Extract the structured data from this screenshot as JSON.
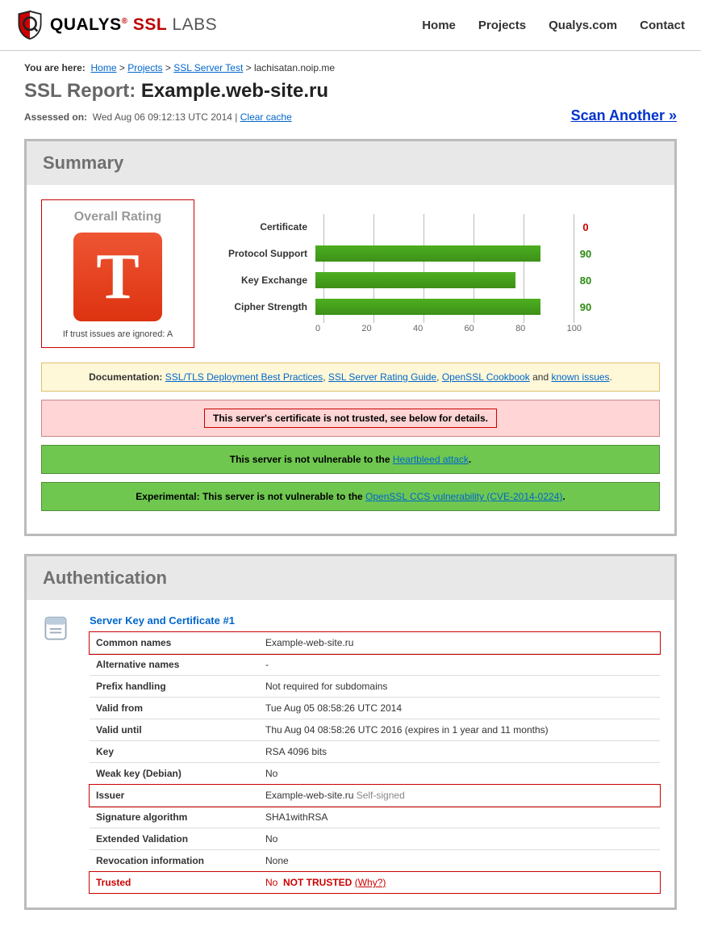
{
  "nav": {
    "home": "Home",
    "projects": "Projects",
    "qualys": "Qualys.com",
    "contact": "Contact"
  },
  "logo": {
    "brand": "QUALYS",
    "reg": "®",
    "ssl": "SSL",
    "labs": " LABS"
  },
  "breadcrumb": {
    "label": "You are here:",
    "home": "Home",
    "projects": "Projects",
    "ssltest": "SSL Server Test",
    "leaf": "lachisatan.noip.me"
  },
  "title": {
    "prefix": "SSL Report: ",
    "host": "Example.web-site.ru"
  },
  "assessed": {
    "label": "Assessed on:",
    "ts": "Wed Aug 06 09:12:13 UTC 2014",
    "clear": "Clear cache"
  },
  "scan_another": "Scan Another »",
  "summary": {
    "heading": "Summary",
    "rating_title": "Overall Rating",
    "grade": "T",
    "rating_note": "If trust issues are ignored: A",
    "axis": [
      "0",
      "20",
      "40",
      "60",
      "80",
      "100"
    ]
  },
  "chart_data": {
    "type": "bar",
    "categories": [
      "Certificate",
      "Protocol Support",
      "Key Exchange",
      "Cipher Strength"
    ],
    "values": [
      0,
      90,
      80,
      90
    ],
    "xlim": [
      0,
      100
    ]
  },
  "docs": {
    "prefix": "Documentation: ",
    "l1": "SSL/TLS Deployment Best Practices",
    "l2": "SSL Server Rating Guide",
    "l3": "OpenSSL Cookbook",
    "mid": " and ",
    "l4": "known issues"
  },
  "alerts": {
    "untrusted": "This server's certificate is not trusted, see below for details.",
    "hb_pre": "This server is not vulnerable to the ",
    "hb_link": "Heartbleed attack",
    "ccs_pre": "Experimental: This server is not vulnerable to the ",
    "ccs_link": "OpenSSL CCS vulnerability (CVE-2014-0224)"
  },
  "auth": {
    "heading": "Authentication",
    "section": "Server Key and Certificate #1",
    "rows": {
      "cn_k": "Common names",
      "cn_v": "Example-web-site.ru",
      "alt_k": "Alternative names",
      "alt_v": "-",
      "pfx_k": "Prefix handling",
      "pfx_v": "Not required for subdomains",
      "vf_k": "Valid from",
      "vf_v": "Tue Aug 05 08:58:26 UTC 2014",
      "vu_k": "Valid until",
      "vu_v": "Thu Aug 04 08:58:26 UTC 2016 (expires in 1 year and 11 months)",
      "key_k": "Key",
      "key_v": "RSA 4096 bits",
      "wk_k": "Weak key (Debian)",
      "wk_v": "No",
      "iss_k": "Issuer",
      "iss_v": "Example-web-site.ru",
      "iss_note": " Self-signed",
      "sig_k": "Signature algorithm",
      "sig_v": "SHA1withRSA",
      "ev_k": "Extended Validation",
      "ev_v": "No",
      "rev_k": "Revocation information",
      "rev_v": "None",
      "tr_k": "Trusted",
      "tr_v1": "No",
      "tr_v2": "NOT TRUSTED",
      "tr_why": "(Why?)"
    }
  }
}
